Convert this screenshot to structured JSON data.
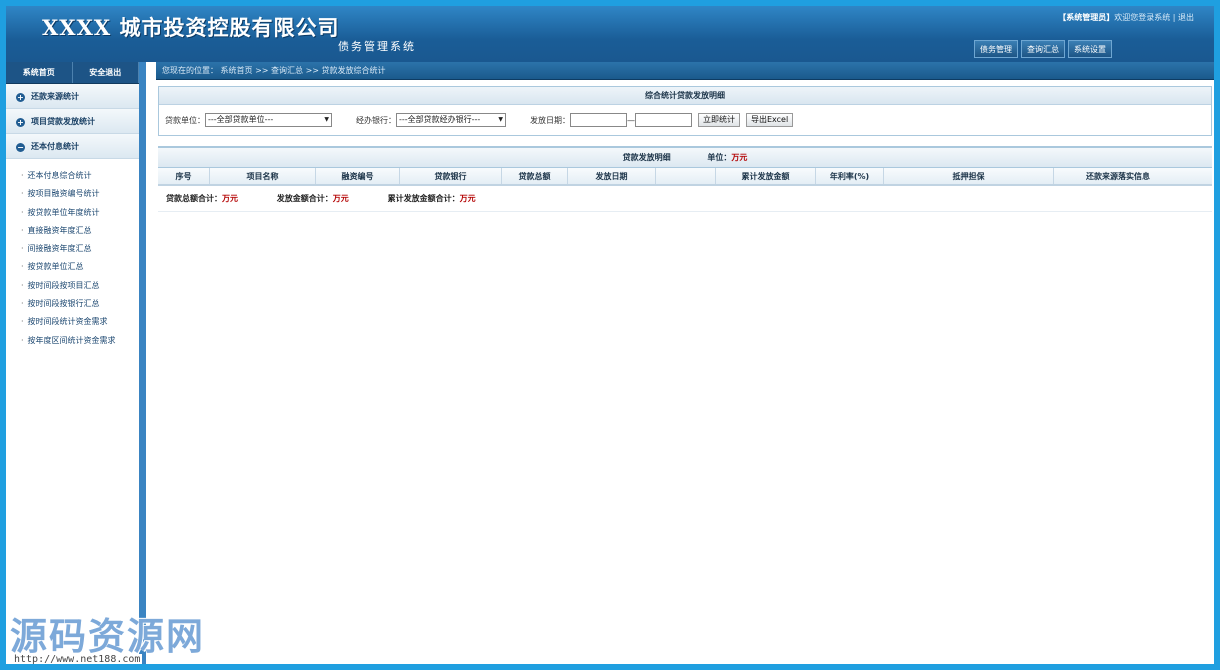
{
  "header": {
    "logo_text": "XXXX 城市投资控股有限公司",
    "subtitle": "债务管理系统",
    "user_role": "【系统管理员】",
    "welcome": "欢迎您登录系统",
    "separator": "|",
    "logout": "退出",
    "nav": [
      "债务管理",
      "查询汇总",
      "系统设置"
    ]
  },
  "sidebar": {
    "top_buttons": [
      "系统首页",
      "安全退出"
    ],
    "sections": [
      {
        "icon": "plus-circle-icon",
        "label": "还款来源统计"
      },
      {
        "icon": "plus-circle-icon",
        "label": "项目贷款发放统计"
      },
      {
        "icon": "minus-circle-icon",
        "label": "还本付息统计"
      }
    ],
    "items": [
      "还本付息综合统计",
      "按项目融资编号统计",
      "按贷款单位年度统计",
      "直接融资年度汇总",
      "间接融资年度汇总",
      "按贷款单位汇总",
      "按时间段按项目汇总",
      "按时间段按银行汇总",
      "按时间段统计资金需求",
      "按年度区间统计资金需求"
    ]
  },
  "breadcrumb": {
    "prefix": "您现在的位置：",
    "path": "系统首页 >> 查询汇总 >> 贷款发放综合统计"
  },
  "filter_panel": {
    "title": "综合统计贷款发放明细",
    "loan_unit_label": "贷款单位：",
    "loan_unit_value": "---全部贷款单位---",
    "bank_label": "经办银行：",
    "bank_value": "---全部贷款经办银行---",
    "date_label": "发放日期：",
    "date_sep": "—",
    "stat_button": "立即统计",
    "export_button": "导出Excel"
  },
  "detail": {
    "title": "贷款发放明细",
    "unit_label": "单位：",
    "unit_value": "万元",
    "columns": [
      "序号",
      "项目名称",
      "融资编号",
      "贷款银行",
      "贷款总额",
      "发放日期",
      "",
      "累计发放金额",
      "年利率(%)",
      "抵押担保",
      "还款来源落实信息"
    ],
    "totals": {
      "loan_total_label": "贷款总额合计：",
      "loan_total_value": "万元",
      "issued_total_label": "发放金额合计：",
      "issued_total_value": "万元",
      "cum_total_label": "累计发放金额合计：",
      "cum_total_value": "万元"
    }
  },
  "watermark": {
    "text": "源码资源网",
    "url": "http://www.net188.com"
  }
}
